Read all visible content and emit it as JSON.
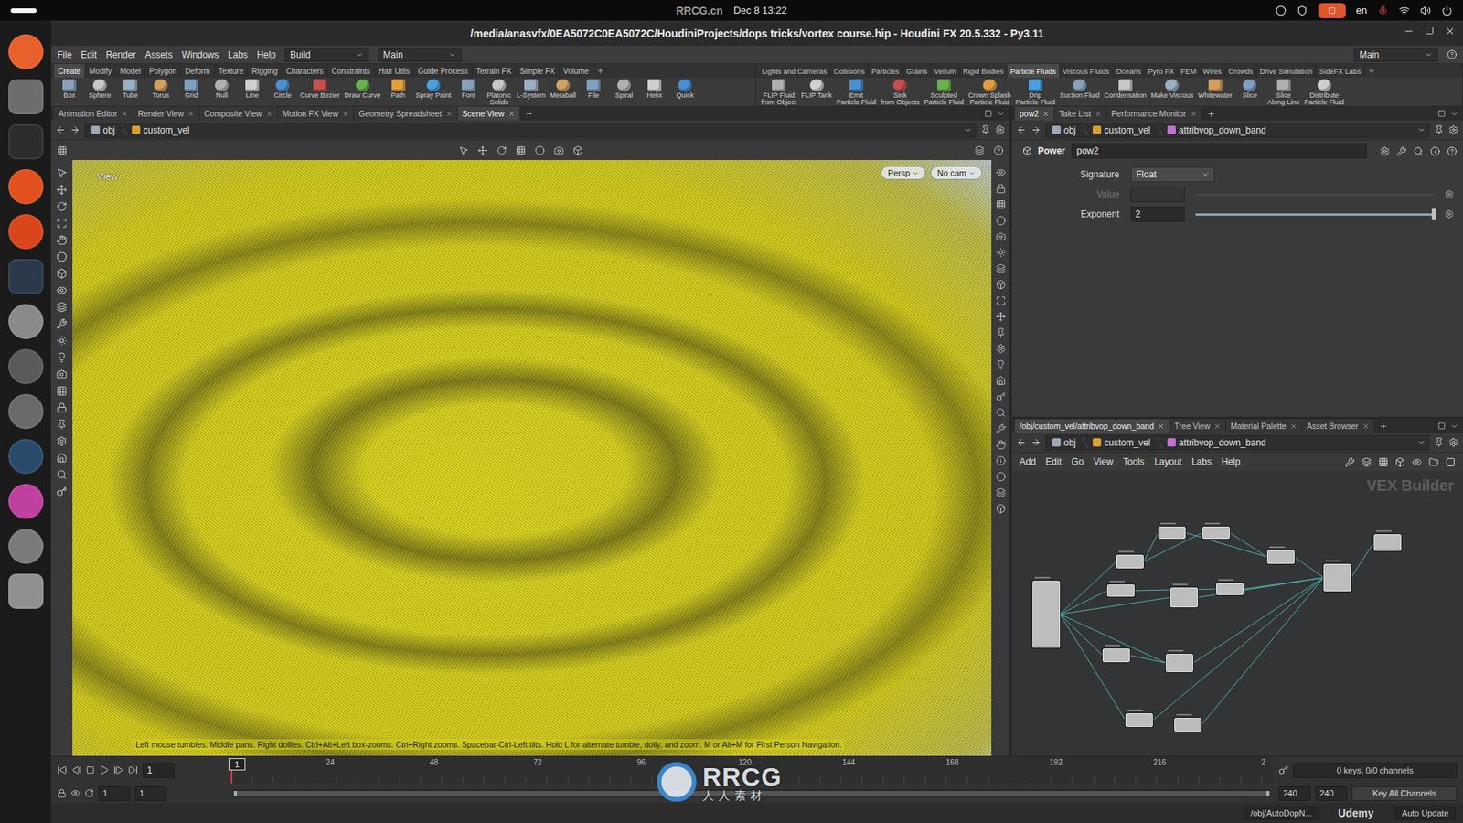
{
  "system_bar": {
    "watermark": "RRCG.cn",
    "clock": "Dec 8 13:22",
    "language": "en"
  },
  "window": {
    "title": "/media/anasvfx/0EA5072C0EA5072C/HoudiniProjects/dops tricks/vortex course.hip - Houdini FX 20.5.332 - Py3.11"
  },
  "menu": [
    "File",
    "Edit",
    "Render",
    "Assets",
    "Windows",
    "Labs",
    "Help"
  ],
  "desktop_menus": [
    "Build",
    "Main"
  ],
  "desktop_right": "Main",
  "shelf_left": {
    "tabs": [
      {
        "label": "Create",
        "selected": true
      },
      {
        "label": "Modify",
        "selected": false
      },
      {
        "label": "Model",
        "selected": false
      },
      {
        "label": "Polygon",
        "selected": false
      },
      {
        "label": "Deform",
        "selected": false
      },
      {
        "label": "Texture",
        "selected": false
      },
      {
        "label": "Rigging",
        "selected": false
      },
      {
        "label": "Characters",
        "selected": false
      },
      {
        "label": "Constraints",
        "selected": false
      },
      {
        "label": "Hair Utils",
        "selected": false
      },
      {
        "label": "Guide Process",
        "selected": false
      },
      {
        "label": "Terrain FX",
        "selected": false
      },
      {
        "label": "Simple FX",
        "selected": false
      },
      {
        "label": "Volume",
        "selected": false
      }
    ],
    "tools": [
      {
        "label": [
          "Box"
        ]
      },
      {
        "label": [
          "Sphere"
        ]
      },
      {
        "label": [
          "Tube"
        ]
      },
      {
        "label": [
          "Torus"
        ]
      },
      {
        "label": [
          "Grid"
        ]
      },
      {
        "label": [
          "Null"
        ]
      },
      {
        "label": [
          "Line"
        ]
      },
      {
        "label": [
          "Circle"
        ]
      },
      {
        "label": [
          "Curve Bezier"
        ]
      },
      {
        "label": [
          "Draw Curve"
        ]
      },
      {
        "label": [
          "Path"
        ]
      },
      {
        "label": [
          "Spray Paint"
        ]
      },
      {
        "label": [
          "Font"
        ]
      },
      {
        "label": [
          "Platonic",
          "Solids"
        ]
      },
      {
        "label": [
          "L-System"
        ]
      },
      {
        "label": [
          "Metaball"
        ]
      },
      {
        "label": [
          "File"
        ]
      },
      {
        "label": [
          "Spiral"
        ]
      },
      {
        "label": [
          "Helix"
        ]
      },
      {
        "label": [
          "Quick"
        ]
      }
    ]
  },
  "shelf_right": {
    "tabs": [
      {
        "label": "Lights and Cameras",
        "selected": false
      },
      {
        "label": "Collisions",
        "selected": false
      },
      {
        "label": "Particles",
        "selected": false
      },
      {
        "label": "Grains",
        "selected": false
      },
      {
        "label": "Vellum",
        "selected": false
      },
      {
        "label": "Rigid Bodies",
        "selected": false
      },
      {
        "label": "Particle Fluids",
        "selected": true
      },
      {
        "label": "Viscous Fluids",
        "selected": false
      },
      {
        "label": "Oceans",
        "selected": false
      },
      {
        "label": "Pyro FX",
        "selected": false
      },
      {
        "label": "FEM",
        "selected": false
      },
      {
        "label": "Wires",
        "selected": false
      },
      {
        "label": "Crowds",
        "selected": false
      },
      {
        "label": "Drive Simulation",
        "selected": false
      },
      {
        "label": "SideFX Labs",
        "selected": false
      }
    ],
    "tools": [
      {
        "label": [
          "FLIP Fluid",
          "from Object"
        ]
      },
      {
        "label": [
          "FLIP Tank"
        ]
      },
      {
        "label": [
          "Emit",
          "Particle Fluid"
        ]
      },
      {
        "label": [
          "Sink",
          "from Objects"
        ]
      },
      {
        "label": [
          "Sculpted",
          "Particle Fluid"
        ]
      },
      {
        "label": [
          "Crown Splash",
          "Particle Fluid"
        ]
      },
      {
        "label": [
          "Drip",
          "Particle Fluid"
        ]
      },
      {
        "label": [
          "Suction Fluid"
        ]
      },
      {
        "label": [
          "Condensation"
        ]
      },
      {
        "label": [
          "Make Viscous"
        ]
      },
      {
        "label": [
          "Whitewater"
        ]
      },
      {
        "label": [
          "Slice"
        ]
      },
      {
        "label": [
          "Slice",
          "Along Line"
        ]
      },
      {
        "label": [
          "Distribute",
          "Particle Fluid"
        ]
      }
    ]
  },
  "viewer": {
    "tabs": [
      {
        "label": "Animation Editor",
        "selected": false
      },
      {
        "label": "Render View",
        "selected": false
      },
      {
        "label": "Composite View",
        "selected": false
      },
      {
        "label": "Motion FX View",
        "selected": false
      },
      {
        "label": "Geometry Spreadsheet",
        "selected": false
      },
      {
        "label": "Scene View",
        "selected": true
      }
    ],
    "path": [
      "obj",
      "custom_vel"
    ],
    "view_label": "View",
    "camera_menus": [
      "Persp",
      "No cam"
    ],
    "hint": "Left mouse tumbles. Middle pans. Right dollies. Ctrl+Alt+Left box-zooms. Ctrl+Right zooms. Spacebar-Ctrl-Left tilts. Hold L for alternate tumble, dolly, and zoom. M or Alt+M for First Person Navigation."
  },
  "parameters": {
    "tabs": [
      {
        "label": "pow2",
        "selected": true
      },
      {
        "label": "Take List",
        "selected": false
      },
      {
        "label": "Performance Monitor",
        "selected": false
      }
    ],
    "path": [
      "obj",
      "custom_vel",
      "attribvop_down_band"
    ],
    "node_type": "Power",
    "node_name": "pow2",
    "params": [
      {
        "label": "Signature",
        "kind": "menu",
        "value": "Float",
        "disabled": false
      },
      {
        "label": "Value",
        "kind": "slider",
        "value": "",
        "disabled": true,
        "level": 0
      },
      {
        "label": "Exponent",
        "kind": "slider",
        "value": "2",
        "disabled": false,
        "level": 1
      }
    ]
  },
  "network": {
    "tabs": [
      {
        "label": "/obj/custom_vel/attribvop_down_band",
        "selected": true
      },
      {
        "label": "Tree View",
        "selected": false
      },
      {
        "label": "Material Palette",
        "selected": false
      },
      {
        "label": "Asset Browser",
        "selected": false
      }
    ],
    "path": [
      "obj",
      "custom_vel",
      "attribvop_down_band"
    ],
    "menu": [
      "Add",
      "Edit",
      "Go",
      "View",
      "Tools",
      "Layout",
      "Labs",
      "Help"
    ],
    "context_label": "VEX Builder"
  },
  "timeline": {
    "frame": "1",
    "ticks": [
      "24",
      "48",
      "72",
      "96",
      "120",
      "144",
      "168",
      "192",
      "216",
      "2"
    ],
    "playhead_level": 0,
    "marker": "1",
    "keys": "0 keys, 0/0 channels"
  },
  "range": {
    "start": "1",
    "start_playback": "1",
    "end_playback": "240",
    "end": "240",
    "level": 1,
    "key_button": "Key All Channels"
  },
  "status_bar": {
    "path": "/obj/AutoDopN...",
    "update_mode": "Auto Update"
  },
  "watermarks": {
    "logo": "RRCG",
    "logo_sub": "人人素材",
    "course": "Udemy"
  }
}
